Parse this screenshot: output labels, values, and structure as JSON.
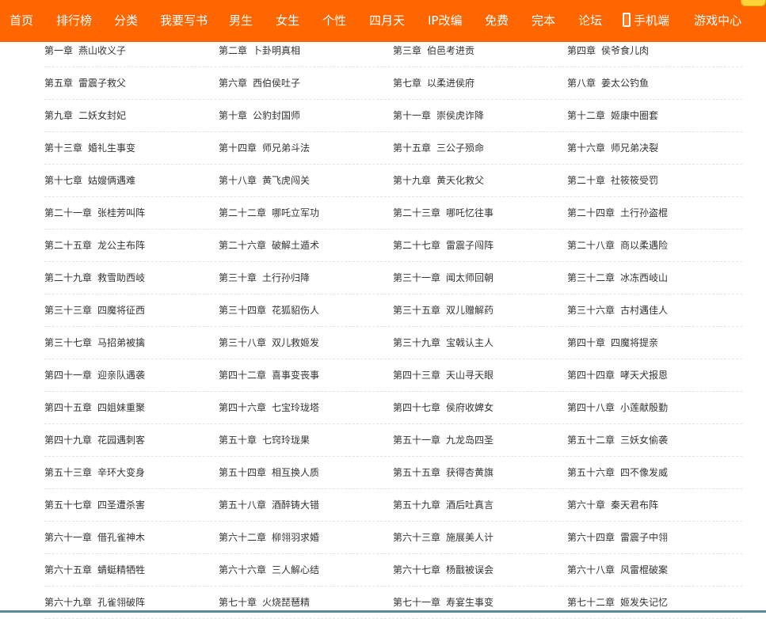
{
  "colors": {
    "nav_background": "#ff6600",
    "nav_text": "#ffffff",
    "chapter_text": "#333333",
    "row_divider": "#e3e3e3",
    "badge": "#ffd43b"
  },
  "nav": {
    "items": [
      {
        "label": "首页"
      },
      {
        "label": "排行榜"
      },
      {
        "label": "分类"
      },
      {
        "label": "我要写书"
      },
      {
        "label": "男生"
      },
      {
        "label": "女生"
      },
      {
        "label": "个性"
      },
      {
        "label": "四月天"
      },
      {
        "label": "IP改编"
      },
      {
        "label": "免费"
      },
      {
        "label": "完本"
      },
      {
        "label": "论坛"
      },
      {
        "label": "手机端",
        "icon": "mobile-phone-icon"
      },
      {
        "label": "游戏中心"
      }
    ]
  },
  "chapters": [
    {
      "num": "第一章",
      "title": "燕山收义子"
    },
    {
      "num": "第二章",
      "title": "卜卦明真相"
    },
    {
      "num": "第三章",
      "title": "伯邑考进贡"
    },
    {
      "num": "第四章",
      "title": "侯爷食儿肉"
    },
    {
      "num": "第五章",
      "title": "雷震子救父"
    },
    {
      "num": "第六章",
      "title": "西伯侯吐子"
    },
    {
      "num": "第七章",
      "title": "以柔进侯府"
    },
    {
      "num": "第八章",
      "title": "姜太公钓鱼"
    },
    {
      "num": "第九章",
      "title": "二妖女封妃"
    },
    {
      "num": "第十章",
      "title": "公豹封国师"
    },
    {
      "num": "第十一章",
      "title": "崇侯虎诈降"
    },
    {
      "num": "第十二章",
      "title": "姬康中圈套"
    },
    {
      "num": "第十三章",
      "title": "婚礼生事变"
    },
    {
      "num": "第十四章",
      "title": "师兄弟斗法"
    },
    {
      "num": "第十五章",
      "title": "三公子殒命"
    },
    {
      "num": "第十六章",
      "title": "师兄弟决裂"
    },
    {
      "num": "第十七章",
      "title": "姑嫂俩遇难"
    },
    {
      "num": "第十八章",
      "title": "黄飞虎闯关"
    },
    {
      "num": "第十九章",
      "title": "黄天化救父"
    },
    {
      "num": "第二十章",
      "title": "社筱筱受罚"
    },
    {
      "num": "第二十一章",
      "title": "张桂芳叫阵"
    },
    {
      "num": "第二十二章",
      "title": "哪吒立军功"
    },
    {
      "num": "第二十三章",
      "title": "哪吒忆往事"
    },
    {
      "num": "第二十四章",
      "title": "土行孙盗棍"
    },
    {
      "num": "第二十五章",
      "title": "龙公主布阵"
    },
    {
      "num": "第二十六章",
      "title": "破解土遁术"
    },
    {
      "num": "第二十七章",
      "title": "雷震子闯阵"
    },
    {
      "num": "第二十八章",
      "title": "商以柔遇险"
    },
    {
      "num": "第二十九章",
      "title": "救雪助西岐"
    },
    {
      "num": "第三十章",
      "title": "土行孙归降"
    },
    {
      "num": "第三十一章",
      "title": "闻太师回朝"
    },
    {
      "num": "第三十二章",
      "title": "冰冻西岐山"
    },
    {
      "num": "第三十三章",
      "title": "四魔将征西"
    },
    {
      "num": "第三十四章",
      "title": "花狐貂伤人"
    },
    {
      "num": "第三十五章",
      "title": "双儿赠解药"
    },
    {
      "num": "第三十六章",
      "title": "古村遇佳人"
    },
    {
      "num": "第三十七章",
      "title": "马招弟被擒"
    },
    {
      "num": "第三十八章",
      "title": "双儿救姬发"
    },
    {
      "num": "第三十九章",
      "title": "宝戟认主人"
    },
    {
      "num": "第四十章",
      "title": "四魔将提亲"
    },
    {
      "num": "第四十一章",
      "title": "迎亲队遇袭"
    },
    {
      "num": "第四十二章",
      "title": "喜事变丧事"
    },
    {
      "num": "第四十三章",
      "title": "天山寻天眼"
    },
    {
      "num": "第四十四章",
      "title": "哮天犬报恩"
    },
    {
      "num": "第四十五章",
      "title": "四姐妹重聚"
    },
    {
      "num": "第四十六章",
      "title": "七宝玲珑塔"
    },
    {
      "num": "第四十七章",
      "title": "侯府收婢女"
    },
    {
      "num": "第四十八章",
      "title": "小莲献殷勤"
    },
    {
      "num": "第四十九章",
      "title": "花园遇刺客"
    },
    {
      "num": "第五十章",
      "title": "七窍玲珑果"
    },
    {
      "num": "第五十一章",
      "title": "九龙岛四圣"
    },
    {
      "num": "第五十二章",
      "title": "三妖女偷袭"
    },
    {
      "num": "第五十三章",
      "title": "辛环大变身"
    },
    {
      "num": "第五十四章",
      "title": "相互换人质"
    },
    {
      "num": "第五十五章",
      "title": "获得杏黄旗"
    },
    {
      "num": "第五十六章",
      "title": "四不像发威"
    },
    {
      "num": "第五十七章",
      "title": "四圣遭杀害"
    },
    {
      "num": "第五十八章",
      "title": "酒醉铸大错"
    },
    {
      "num": "第五十九章",
      "title": "酒后吐真言"
    },
    {
      "num": "第六十章",
      "title": "秦天君布阵"
    },
    {
      "num": "第六十一章",
      "title": "借孔雀神木"
    },
    {
      "num": "第六十二章",
      "title": "柳翎羽求婚"
    },
    {
      "num": "第六十三章",
      "title": "施展美人计"
    },
    {
      "num": "第六十四章",
      "title": "雷震子中翎"
    },
    {
      "num": "第六十五章",
      "title": "蜻蜓精牺牲"
    },
    {
      "num": "第六十六章",
      "title": "三人解心结"
    },
    {
      "num": "第六十七章",
      "title": "杨戬被误会"
    },
    {
      "num": "第六十八章",
      "title": "风雷棍破案"
    },
    {
      "num": "第六十九章",
      "title": "孔雀翎破阵"
    },
    {
      "num": "第七十章",
      "title": "火烧琵琶精"
    },
    {
      "num": "第七十一章",
      "title": "寿宴生事变"
    },
    {
      "num": "第七十二章",
      "title": "姬发失记忆"
    }
  ]
}
